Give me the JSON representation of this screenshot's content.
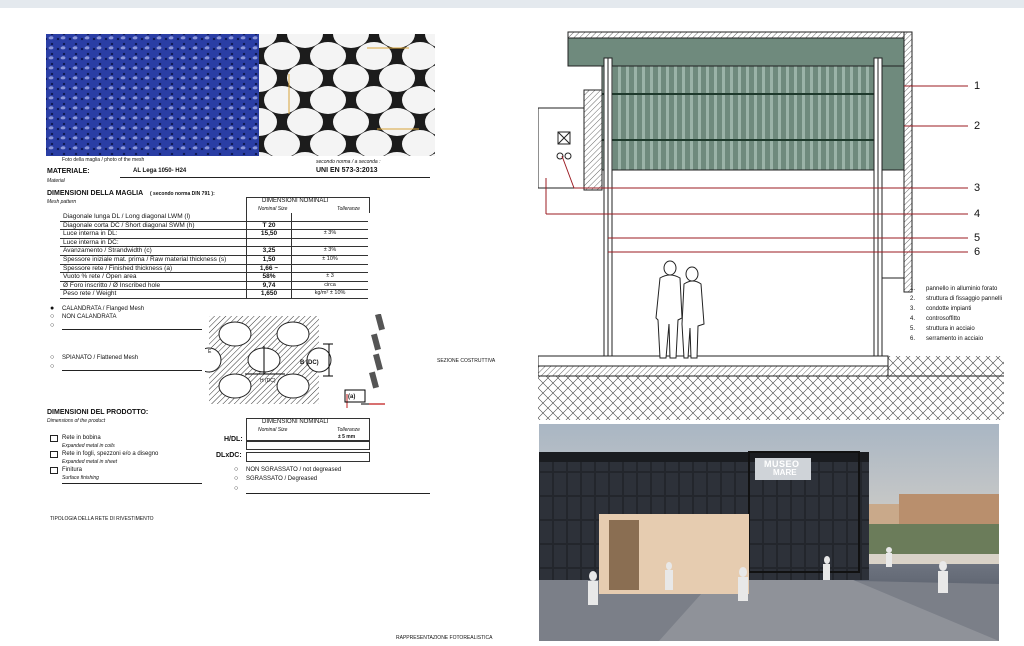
{
  "sheet": {
    "photo_caption": "Foto della maglia / photo of the mesh",
    "norm_note": "secondo norma / a seconda :",
    "norm": "UNI EN 573-3:2013",
    "material_label": "MATERIALE:",
    "material_sub": "Material",
    "material_value": "AL Lega 1050- H24",
    "dims_mesh_title": "DIMENSIONI DELLA MAGLIA",
    "dims_mesh_title_note": "( secondo norma DIN 791 ):",
    "dims_mesh_sub": "Mesh pattern",
    "nominal_head": "DIMENSIONI NOMINALI",
    "nominal_size": "Nominal Size",
    "tolerance": "Tolleranze",
    "rows": [
      {
        "label": "Diagonale lunga DL / Long diagonal LWM (l)",
        "value": "",
        "tol": ""
      },
      {
        "label": "Diagonale corta DC / Short diagonal SWM (h)",
        "value": "T 20",
        "tol": ""
      },
      {
        "label": "Luce interna in DL:",
        "value": "15,50",
        "tol": "± 3%"
      },
      {
        "label": "Luce interna in DC:",
        "value": "",
        "tol": ""
      },
      {
        "label": "Avanzamento / Strandwidth (c)",
        "value": "3,25",
        "tol": "± 3%"
      },
      {
        "label": "Spessore iniziale mat. prima / Raw material thickness (s)",
        "value": "1,50",
        "tol": "± 10%"
      },
      {
        "label": "Spessore rete / Finished thickness (a)",
        "value": "1,66 ~",
        "tol": ""
      },
      {
        "label": "Vuoto % rete / Open area",
        "value": "58%",
        "tol": "± 3"
      },
      {
        "label": "Ø Foro inscritto / Ø Inscribed hole",
        "value": "9,74",
        "tol": "circa"
      },
      {
        "label": "Peso rete / Weight",
        "value": "1,650",
        "tol": "kg/m² ± 10%"
      }
    ],
    "options_top": [
      {
        "label": "CALANDRATA / Flanged Mesh",
        "selected": true
      },
      {
        "label": "NON CALANDRATA",
        "selected": false
      }
    ],
    "spianato": "SPIANATO / Flattened Mesh",
    "sezione_costruttiva": "SEZIONE COSTRUTTIVA",
    "diagram_labels": {
      "b": "B (DC)",
      "h": "H (DC)",
      "a_label": "(a)",
      "e": "E"
    },
    "dims_product_title": "DIMENSIONI DEL PRODOTTO:",
    "dims_product_sub": "Dimensions of the product",
    "product_nominal_head": "DIMENSIONI NOMINALI",
    "product_tol_value": "± 5 mm",
    "product_options": [
      {
        "label": "Rete in bobina",
        "sub": "Expanded metal in coils"
      },
      {
        "label": "Rete in fogli, spezzoni e/o a disegno",
        "sub": "Expanded metal in sheet"
      },
      {
        "label": "Finitura",
        "sub": "Surface finishing"
      }
    ],
    "hdl": "H/DL:",
    "dlxdc": "DLxDC:",
    "grease_options": [
      {
        "label": "NON SGRASSATO / not degreased"
      },
      {
        "label": "SGRASSATO / Degreased"
      }
    ],
    "tipologia": "TIPOLOGIA DELLA RETE DI RIVESTIMENTO",
    "render_caption": "RAPPRESENTAZIONE FOTOREALISTICA"
  },
  "section": {
    "callouts": [
      "1",
      "2",
      "3",
      "4",
      "5",
      "6"
    ],
    "legend": [
      {
        "n": "1.",
        "text": "pannello in alluminio forato"
      },
      {
        "n": "2.",
        "text": "struttura di fissaggio pannelli"
      },
      {
        "n": "3.",
        "text": "condotte impianti"
      },
      {
        "n": "4.",
        "text": "controsoffitto"
      },
      {
        "n": "5.",
        "text": "struttura in acciaio"
      },
      {
        "n": "6.",
        "text": "serramento in acciaio"
      }
    ]
  },
  "render": {
    "sign_line1": "MUSEO",
    "sign_line2": "MARE"
  },
  "colors": {
    "callout_red": "#9b1b22",
    "mesh_blue": "#1d2f86",
    "panel_green": "#4f6a5c"
  }
}
